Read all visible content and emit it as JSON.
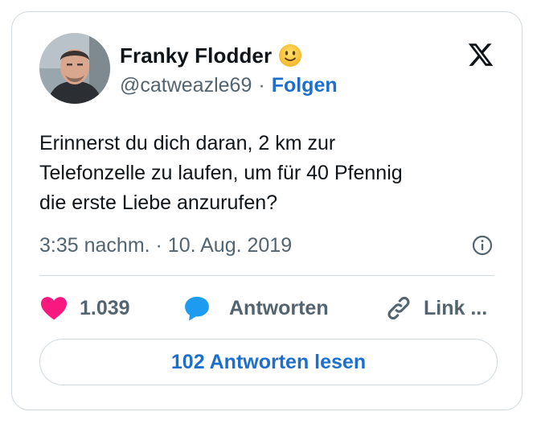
{
  "author": {
    "name": "Franky Flodder",
    "handle": "@catweazle69",
    "separator": "·",
    "follow_label": "Folgen"
  },
  "tweet": {
    "lines": [
      "Erinnerst du dich daran, 2 km zur",
      "Telefonzelle zu laufen, um für 40 Pfennig",
      "die erste Liebe anzurufen?"
    ],
    "timestamp": "3:35 nachm. · 10. Aug. 2019"
  },
  "actions": {
    "likes": "1.039",
    "reply_label": "Antworten",
    "link_label": "Link ..."
  },
  "read_replies_label": "102 Antworten lesen",
  "colors": {
    "accent": "#1d6fce",
    "secondary_text": "#536471",
    "heart": "#f91880",
    "reply_bubble": "#1d9bf0",
    "border": "#cfd9de"
  },
  "icons": {
    "brand": "x-logo-icon",
    "info": "info-icon",
    "like": "heart-icon",
    "reply": "speech-bubble-icon",
    "link": "link-icon",
    "emoji": "slightly-smiling-face-icon"
  }
}
